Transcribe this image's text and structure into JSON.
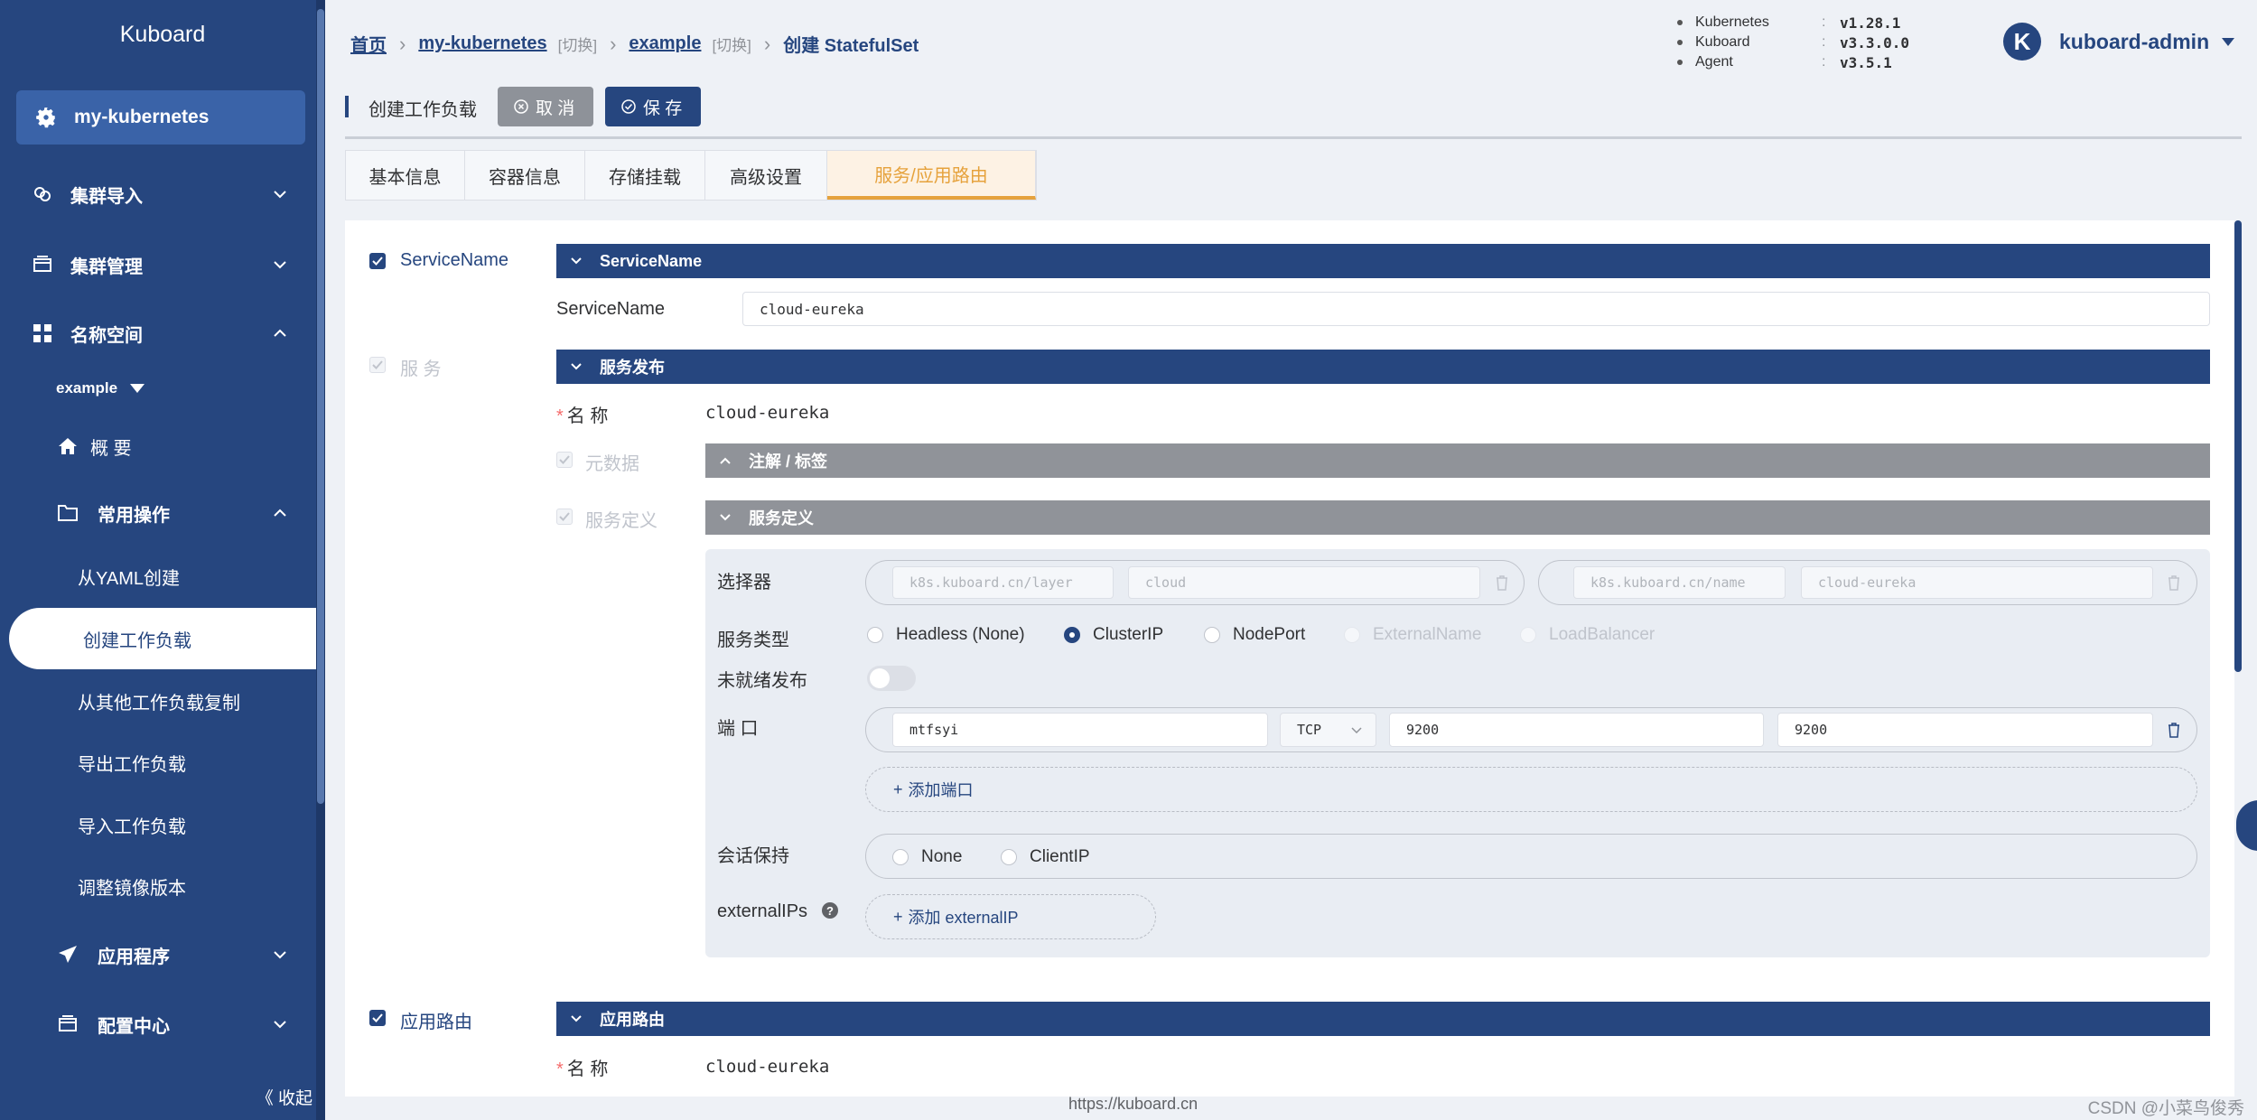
{
  "sidebar": {
    "logo": "Kuboard",
    "cluster": "my-kubernetes",
    "menu": {
      "import": "集群导入",
      "manage": "集群管理",
      "namespace": "名称空间",
      "ns_selected": "example",
      "overview": "概 要",
      "common_ops": "常用操作",
      "from_yaml": "从YAML创建",
      "create_workload": "创建工作负载",
      "copy_workload": "从其他工作负载复制",
      "export_workload": "导出工作负载",
      "import_workload": "导入工作负载",
      "adjust_image": "调整镜像版本",
      "apps": "应用程序",
      "config": "配置中心"
    },
    "collapse": "《 收起"
  },
  "header": {
    "breadcrumb": {
      "home": "首页",
      "cluster": "my-kubernetes",
      "cluster_switch": "[切换]",
      "namespace": "example",
      "ns_switch": "[切换]",
      "current": "创建 StatefulSet"
    },
    "versions": [
      {
        "name": "Kubernetes",
        "colon": ":",
        "value": "v1.28.1"
      },
      {
        "name": "Kuboard",
        "colon": ":",
        "value": "v3.3.0.0"
      },
      {
        "name": "Agent",
        "colon": ":",
        "value": "v3.5.1"
      }
    ],
    "user_initial": "K",
    "user": "kuboard-admin"
  },
  "actionbar": {
    "title": "创建工作负载",
    "cancel": "取 消",
    "save": "保 存"
  },
  "tabs": [
    "基本信息",
    "容器信息",
    "存储挂载",
    "高级设置",
    "服务/应用路由"
  ],
  "form": {
    "service_name_check": "ServiceName",
    "service_name_section": "ServiceName",
    "service_name_label": "ServiceName",
    "service_name_value": "cloud-eureka",
    "service_check": "服 务",
    "service_publish_section": "服务发布",
    "name_label": "名 称",
    "name_value": "cloud-eureka",
    "metadata_check": "元数据",
    "annotations_section": "注解 / 标签",
    "service_def_check": "服务定义",
    "service_def_section": "服务定义",
    "selector_label": "选择器",
    "selectors": [
      {
        "key": "k8s.kuboard.cn/layer",
        "value": "cloud"
      },
      {
        "key": "k8s.kuboard.cn/name",
        "value": "cloud-eureka"
      }
    ],
    "service_type_label": "服务类型",
    "service_types": [
      "Headless (None)",
      "ClusterIP",
      "NodePort",
      "ExternalName",
      "LoadBalancer"
    ],
    "unready_label": "未就绪发布",
    "port_label": "端 口",
    "port": {
      "name": "mtfsyi",
      "protocol": "TCP",
      "port": "9200",
      "target": "9200"
    },
    "add_port": "添加端口",
    "session_label": "会话保持",
    "session_options": [
      "None",
      "ClientIP"
    ],
    "external_ips_label": "externalIPs",
    "help": "?",
    "add_external_ip": "添加 externalIP",
    "ingress_check": "应用路由",
    "ingress_section": "应用路由",
    "ingress_name_label": "名 称",
    "ingress_name_value": "cloud-eureka"
  },
  "footer": {
    "url": "https://kuboard.cn",
    "watermark": "CSDN @小菜鸟俊秀"
  }
}
